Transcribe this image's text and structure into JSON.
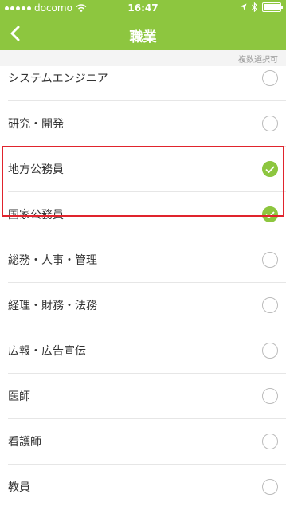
{
  "status": {
    "carrier": "docomo",
    "time": "16:47"
  },
  "nav": {
    "title": "職業"
  },
  "note": "複数選択可",
  "items": [
    {
      "label": "システムエンジニア",
      "checked": false
    },
    {
      "label": "研究・開発",
      "checked": false
    },
    {
      "label": "地方公務員",
      "checked": true
    },
    {
      "label": "国家公務員",
      "checked": true
    },
    {
      "label": "総務・人事・管理",
      "checked": false
    },
    {
      "label": "経理・財務・法務",
      "checked": false
    },
    {
      "label": "広報・広告宣伝",
      "checked": false
    },
    {
      "label": "医師",
      "checked": false
    },
    {
      "label": "看護師",
      "checked": false
    },
    {
      "label": "教員",
      "checked": false
    }
  ],
  "colors": {
    "accent": "#8dc63f",
    "highlight": "#e0242d"
  }
}
